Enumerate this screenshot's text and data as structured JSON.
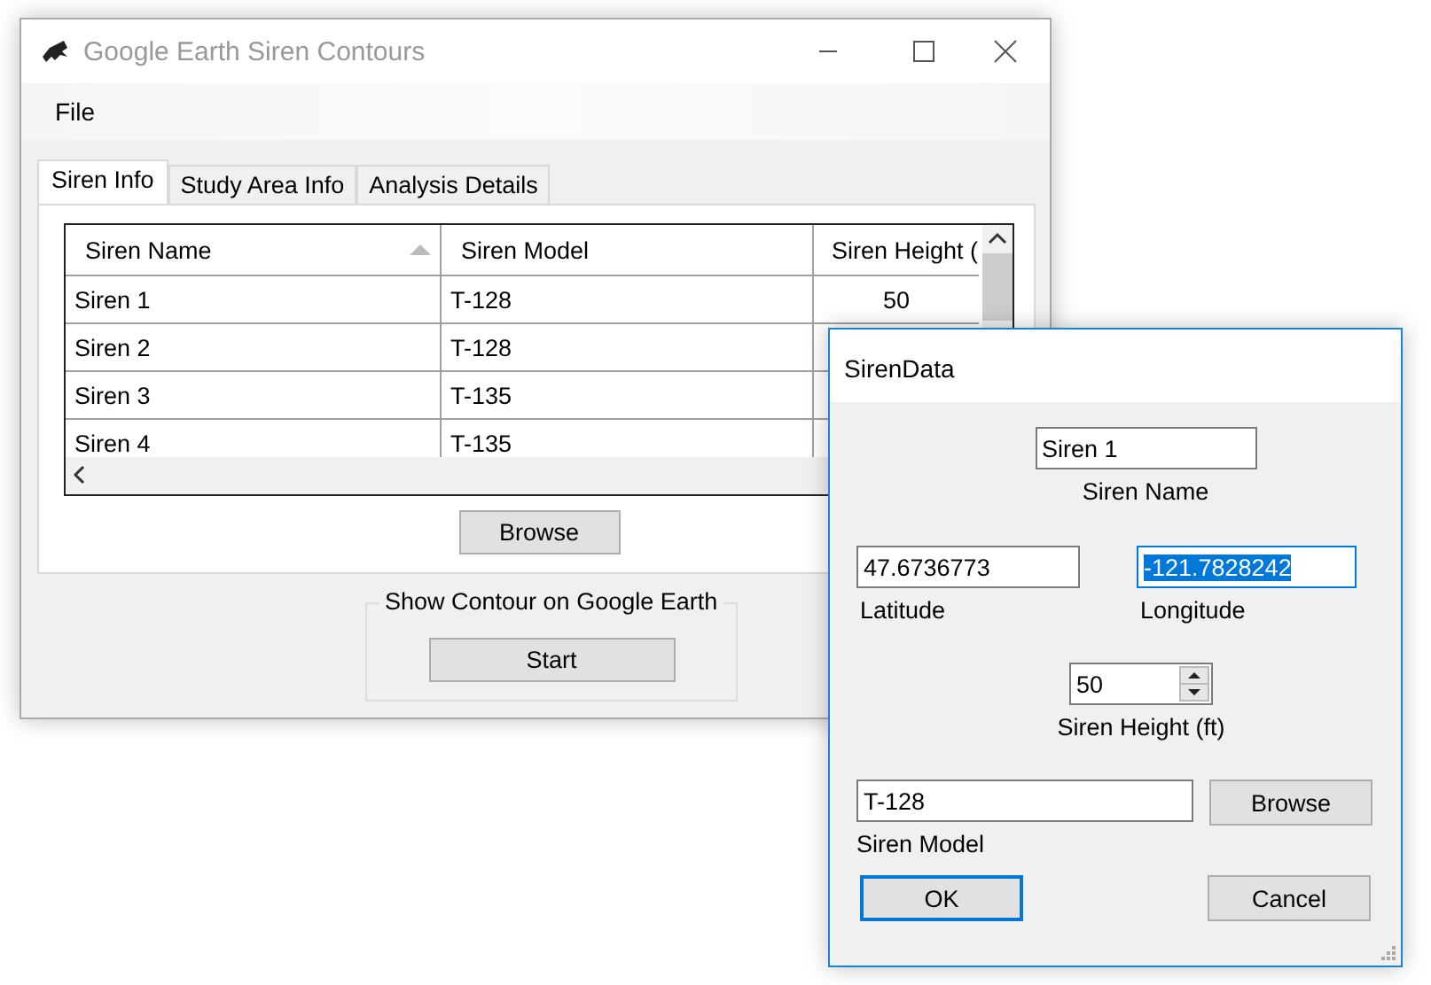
{
  "main_window": {
    "title": "Google Earth Siren Contours",
    "menu": [
      {
        "label": "File"
      }
    ],
    "tabs": [
      {
        "label": "Siren Info",
        "selected": true
      },
      {
        "label": "Study Area Info",
        "selected": false
      },
      {
        "label": "Analysis Details",
        "selected": false
      }
    ],
    "table": {
      "columns": [
        {
          "label": "Siren Name",
          "sorted_ascending": true
        },
        {
          "label": "Siren Model"
        },
        {
          "label": "Siren Height ("
        }
      ],
      "rows": [
        [
          "Siren 1",
          "T-128",
          "50"
        ],
        [
          "Siren 2",
          "T-128"
        ],
        [
          "Siren 3",
          "T-135"
        ],
        [
          "Siren 4",
          "T-135"
        ]
      ]
    },
    "browse_button": "Browse",
    "group": {
      "title": "Show Contour on Google Earth",
      "button": "Start"
    }
  },
  "dialog": {
    "title": "SirenData",
    "name_field": {
      "value": "Siren 1",
      "label": "Siren Name"
    },
    "latitude_field": {
      "value": "47.6736773",
      "label": "Latitude"
    },
    "longitude_field": {
      "value": "-121.7828242",
      "label": "Longitude",
      "text_selected": true
    },
    "height_field": {
      "value": "50",
      "label": "Siren Height (ft)"
    },
    "model_field": {
      "value": "T-128",
      "label": "Siren Model"
    },
    "browse_button": "Browse",
    "ok_button": {
      "label": "OK",
      "default": true
    },
    "cancel_button": {
      "label": "Cancel",
      "default": false
    }
  }
}
